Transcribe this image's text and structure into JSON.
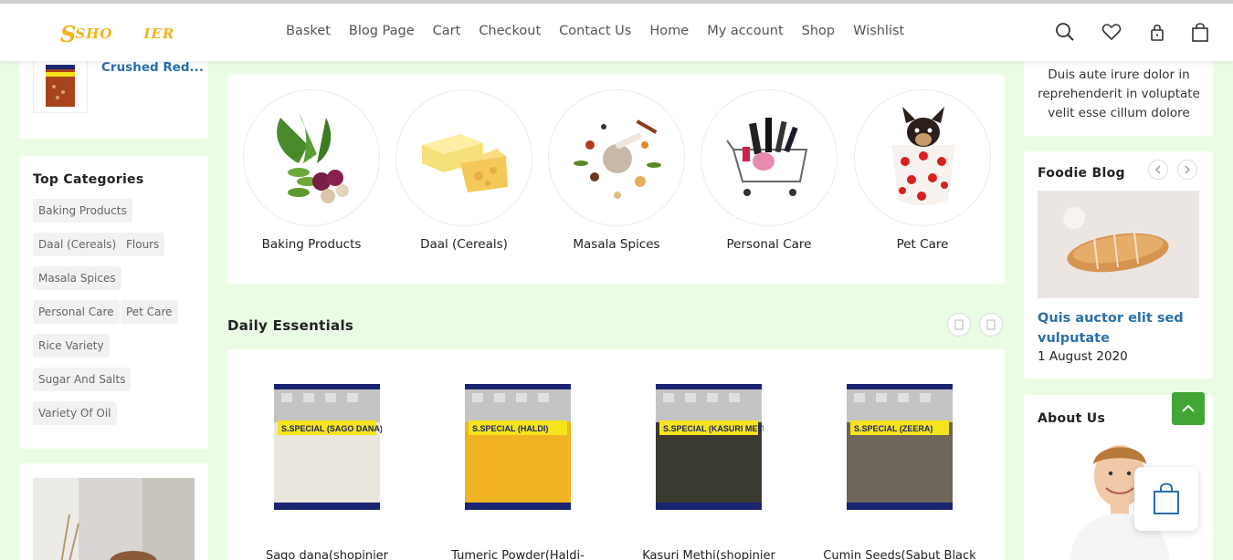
{
  "header": {
    "logo_part1": "SHO",
    "logo_part2": "IER",
    "nav": [
      "Basket",
      "Blog Page",
      "Cart",
      "Checkout",
      "Contact Us",
      "Home",
      "My account",
      "Shop",
      "Wishlist"
    ]
  },
  "left": {
    "recent_product": "Crushed Red...",
    "top_categories_title": "Top Categories",
    "tags": [
      "Baking Products",
      "Daal (Cereals)",
      "Flours",
      "Masala Spices",
      "Personal Care",
      "Pet Care",
      "Rice Variety",
      "Sugar And Salts",
      "Variety Of Oil"
    ]
  },
  "categories": [
    {
      "label": "Baking Products",
      "icon": "vegetables-image"
    },
    {
      "label": "Daal (Cereals)",
      "icon": "cheese-image"
    },
    {
      "label": "Masala Spices",
      "icon": "spices-image"
    },
    {
      "label": "Personal Care",
      "icon": "cosmetics-cart-image"
    },
    {
      "label": "Pet Care",
      "icon": "puppy-cup-image"
    }
  ],
  "daily": {
    "title": "Daily Essentials",
    "products": [
      {
        "label": "Sago dana(shopinier",
        "pack_text": "S.SPECIAL",
        "pack_sub": "(SAGO DANA)",
        "fill": "#e8e6dd"
      },
      {
        "label": "Tumeric Powder(Haldi-",
        "pack_text": "S.SPECIAL",
        "pack_sub": "(HALDI)",
        "fill": "#f0b323"
      },
      {
        "label": "Kasuri Methi(shopinier",
        "pack_text": "S.SPECIAL",
        "pack_sub": "(KASURI METHI)",
        "fill": "#3b3a30"
      },
      {
        "label": "Cumin Seeds(Sabut Black",
        "pack_text": "S.SPECIAL",
        "pack_sub": "(ZEERA)",
        "fill": "#6e665a"
      }
    ]
  },
  "right": {
    "intro_text": "Duis aute irure dolor in reprehenderit in voluptate velit esse cillum dolore",
    "blog_title": "Foodie Blog",
    "post_title": "Quis auctor elit sed vulputate",
    "post_date": "1 August 2020",
    "about_title": "About Us"
  },
  "colors": {
    "accent": "#f2b21a",
    "link": "#2a6fad",
    "green": "#41a634",
    "bg": "#eafde4"
  }
}
